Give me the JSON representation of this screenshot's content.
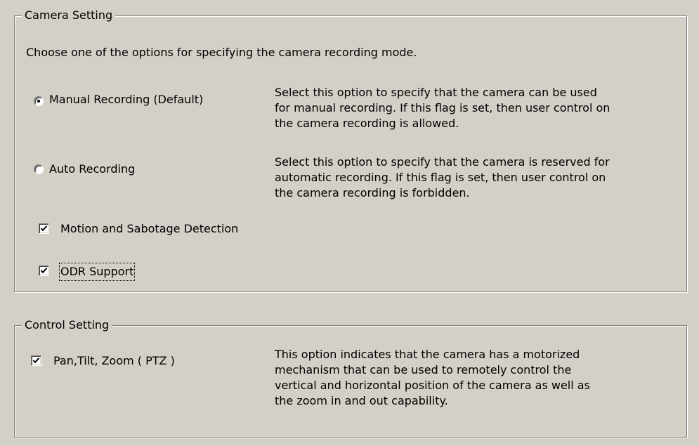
{
  "camera_setting": {
    "title": "Camera Setting",
    "instruction": "Choose one of the options for specifying the camera recording mode.",
    "manual": {
      "label": "Manual Recording (Default)",
      "checked": true,
      "description": [
        "Select this option to specify that the camera can be used",
        "for manual recording. If this flag is set, then user control on",
        "the camera recording is allowed."
      ]
    },
    "auto": {
      "label": "Auto Recording",
      "checked": false,
      "description": [
        "Select this option to specify that the camera is reserved for",
        "automatic recording. If this flag is set, then user control on",
        "the camera recording is forbidden."
      ]
    },
    "motion": {
      "label": "Motion and Sabotage Detection",
      "checked": true
    },
    "odr": {
      "label": "ODR Support",
      "checked": true
    }
  },
  "control_setting": {
    "title": "Control Setting",
    "ptz": {
      "label": "Pan,Tilt, Zoom ( PTZ )",
      "checked": true,
      "description": [
        "This option indicates that the camera has a motorized",
        "mechanism that can be used to remotely control the",
        "vertical and horizontal position of the camera as well as",
        "the zoom in and out capability."
      ]
    }
  }
}
